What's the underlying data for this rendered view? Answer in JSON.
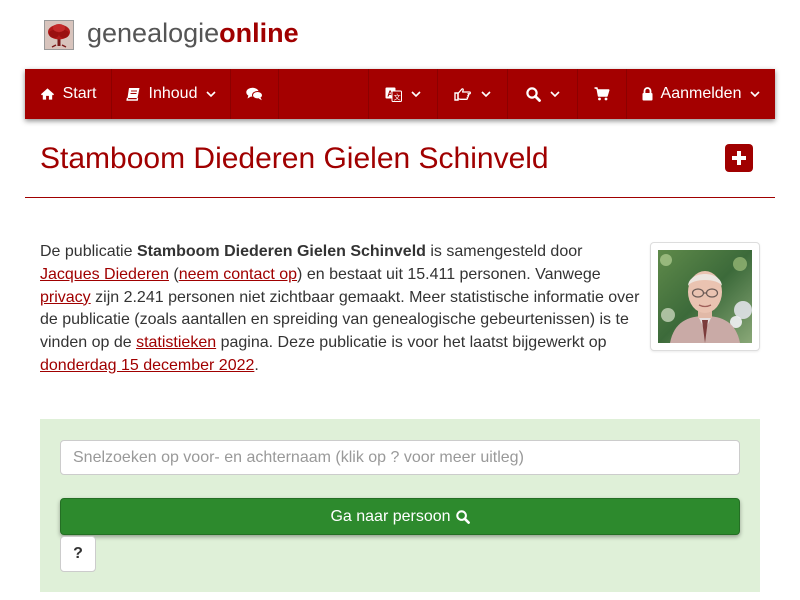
{
  "header": {
    "logo_part1": "genealogie",
    "logo_part2": "online"
  },
  "nav": {
    "start_label": "Start",
    "inhoud_label": "Inhoud",
    "aanmelden_label": "Aanmelden",
    "icons": [
      "home-icon",
      "book-icon",
      "comments-icon",
      "translate-icon",
      "hand-pointer-icon",
      "search-icon",
      "shopping-cart-icon",
      "lock-icon"
    ]
  },
  "page": {
    "title": "Stamboom Diederen Gielen Schinveld"
  },
  "intro": {
    "t1": "De publicatie ",
    "pub_name": "Stamboom Diederen Gielen Schinveld",
    "t2": " is samengesteld door ",
    "author_link": "Jacques Diederen",
    "t3": " (",
    "contact_link": "neem contact op",
    "t4": ") en bestaat uit 15.411 personen. Vanwege ",
    "privacy_link": "privacy",
    "t5": " zijn 2.241 personen niet zichtbaar gemaakt. Meer statistische informatie over de publicatie (zoals aantallen en spreiding van genealogische gebeurtenissen) is te vinden op de ",
    "stats_link": "statistieken",
    "t6": " pagina. Deze publicatie is voor het laatst bijgewerkt op ",
    "date_link": "donderdag 15 december 2022",
    "t7": "."
  },
  "search": {
    "placeholder": "Snelzoeken op voor- en achternaam (klik op ? voor meer uitleg)",
    "value": "",
    "go_label": "Ga naar persoon",
    "help_label": "?"
  },
  "colors": {
    "brand_red": "#a40000",
    "link_red": "#a00000",
    "panel_green": "#dff0d8",
    "button_green": "#2d8a2d"
  }
}
